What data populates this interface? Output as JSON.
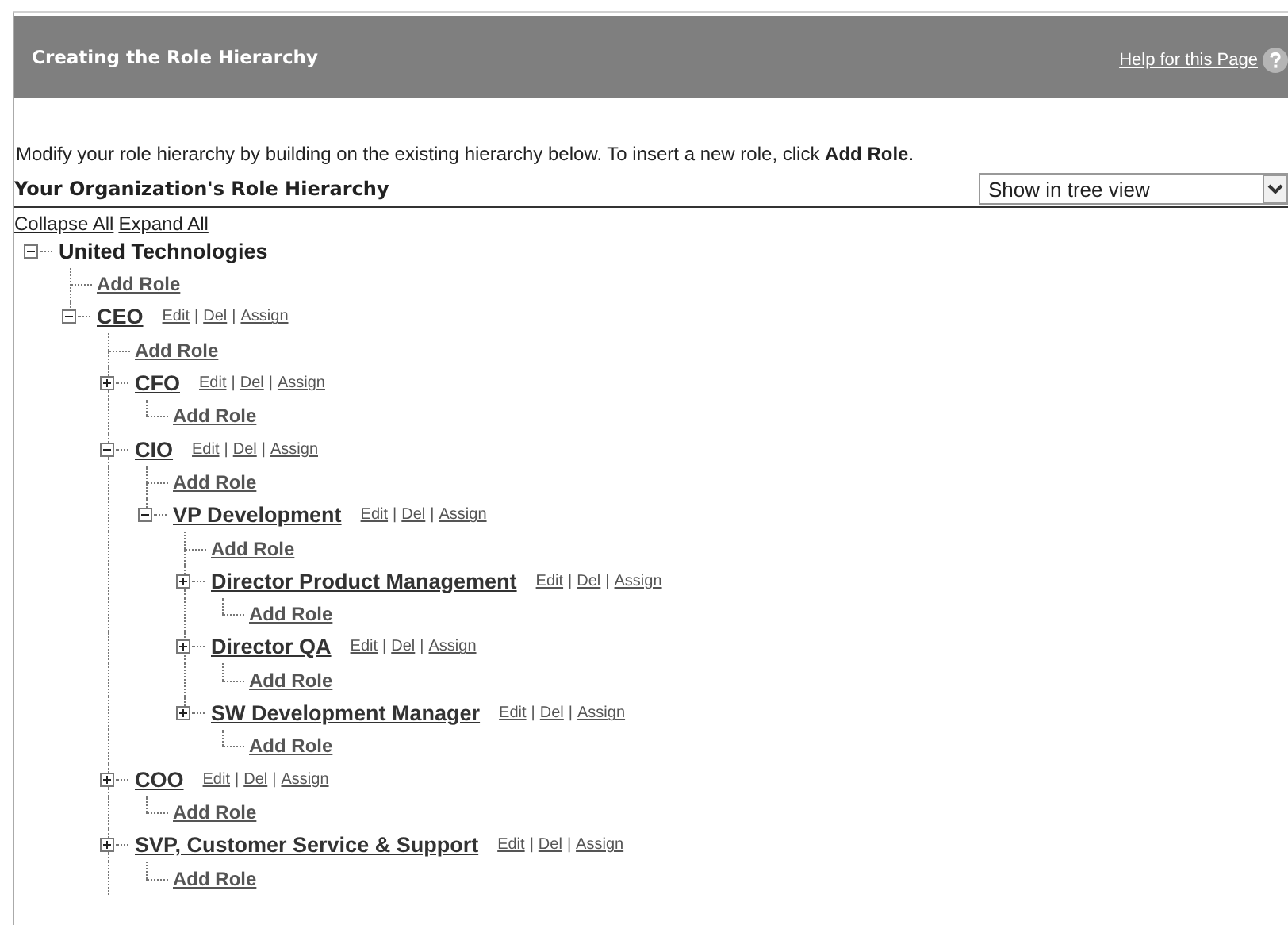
{
  "header": {
    "title": "Creating the Role Hierarchy",
    "help_link": "Help for this Page"
  },
  "intro": "Modify your role hierarchy by building on the existing hierarchy below. To insert a new role, click **Add Role**.",
  "section": {
    "title": "Your Organization's Role Hierarchy",
    "view_select": "Show in tree view"
  },
  "tree_controls": [
    "Collapse All",
    "Expand All"
  ],
  "tree": {
    "kind": "organization",
    "name": "United Technologies",
    "expanded": true,
    "add_role": "Add Role",
    "children": [
      {
        "kind": "role",
        "name": "CEO",
        "expanded": true,
        "more_children_below": true,
        "add_role": "Add Role",
        "actions": [
          {
            "label": "Edit",
            "separator": "|"
          },
          {
            "label": "Del",
            "separator": "|"
          },
          {
            "label": "Assign"
          }
        ],
        "children": [
          {
            "kind": "role",
            "name": "CFO",
            "expanded": false,
            "add_role": "Add Role",
            "actions": [
              {
                "label": "Edit",
                "separator": "|"
              },
              {
                "label": "Del",
                "separator": "|"
              },
              {
                "label": "Assign"
              }
            ]
          },
          {
            "kind": "role",
            "name": "CIO",
            "expanded": true,
            "add_role": "Add Role",
            "actions": [
              {
                "label": "Edit",
                "separator": "|"
              },
              {
                "label": "Del",
                "separator": "|"
              },
              {
                "label": "Assign"
              }
            ],
            "children": [
              {
                "kind": "role",
                "name": "VP Development",
                "expanded": true,
                "add_role": "Add Role",
                "actions": [
                  {
                    "label": "Edit",
                    "separator": "|"
                  },
                  {
                    "label": "Del",
                    "separator": "|"
                  },
                  {
                    "label": "Assign"
                  }
                ],
                "children": [
                  {
                    "kind": "role",
                    "name": "Director Product Management",
                    "expanded": false,
                    "add_role": "Add Role",
                    "actions": [
                      {
                        "label": "Edit",
                        "separator": "|"
                      },
                      {
                        "label": "Del",
                        "separator": "|"
                      },
                      {
                        "label": "Assign"
                      }
                    ]
                  },
                  {
                    "kind": "role",
                    "name": "Director QA",
                    "expanded": false,
                    "add_role": "Add Role",
                    "actions": [
                      {
                        "label": "Edit",
                        "separator": "|"
                      },
                      {
                        "label": "Del",
                        "separator": "|"
                      },
                      {
                        "label": "Assign"
                      }
                    ]
                  },
                  {
                    "kind": "role",
                    "name": "SW Development Manager",
                    "expanded": false,
                    "add_role": "Add Role",
                    "actions": [
                      {
                        "label": "Edit",
                        "separator": "|"
                      },
                      {
                        "label": "Del",
                        "separator": "|"
                      },
                      {
                        "label": "Assign"
                      }
                    ]
                  }
                ]
              }
            ]
          },
          {
            "kind": "role",
            "name": "COO",
            "expanded": false,
            "add_role": "Add Role",
            "actions": [
              {
                "label": "Edit",
                "separator": "|"
              },
              {
                "label": "Del",
                "separator": "|"
              },
              {
                "label": "Assign"
              }
            ]
          },
          {
            "kind": "role",
            "name": "SVP, Customer Service & Support",
            "expanded": false,
            "add_role": "Add Role",
            "actions": [
              {
                "label": "Edit",
                "separator": "|"
              },
              {
                "label": "Del",
                "separator": "|"
              },
              {
                "label": "Assign"
              }
            ]
          }
        ]
      }
    ]
  }
}
